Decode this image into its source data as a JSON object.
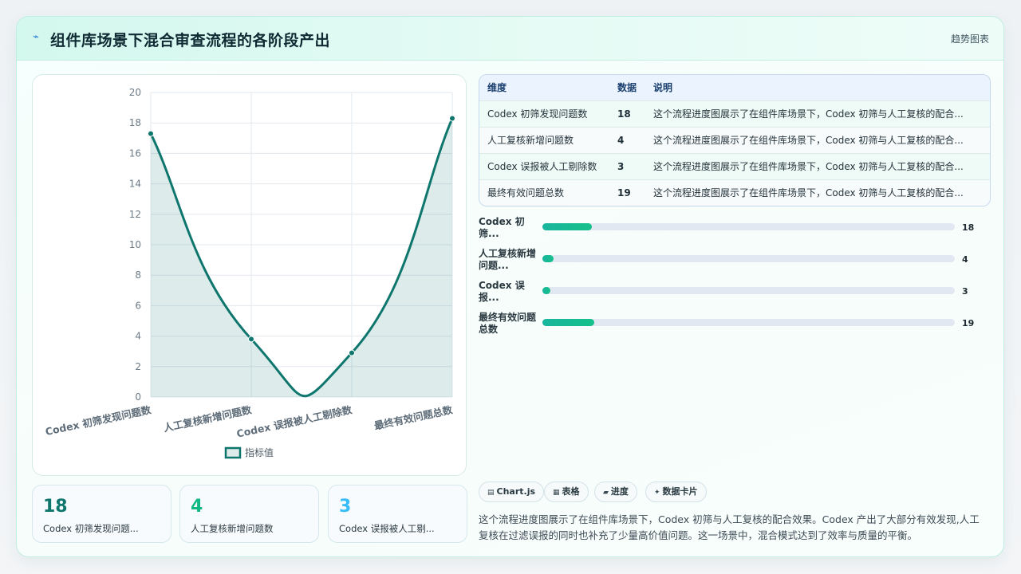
{
  "header": {
    "icon": "lightning-icon",
    "title": "组件库场景下混合审查流程的各阶段产出",
    "tag": "趋势图表"
  },
  "chart_data": {
    "type": "area",
    "categories": [
      "Codex 初筛发现问题数",
      "人工复核新增问题数",
      "Codex 误报被人工剔除数",
      "最终有效问题总数"
    ],
    "series": [
      {
        "name": "指标值",
        "values": [
          17.3,
          3.8,
          2.9,
          18.3
        ]
      }
    ],
    "y_ticks": [
      "0",
      "2",
      "4",
      "6",
      "8",
      "10",
      "12",
      "14",
      "16",
      "18",
      "20"
    ],
    "ylim": [
      0,
      20
    ],
    "grid": true,
    "legend": "bottom",
    "colors": {
      "line": "#0f766e",
      "fill": "rgba(15,118,110,0.14)"
    }
  },
  "table": {
    "headers": [
      "维度",
      "数据",
      "说明"
    ],
    "rows": [
      {
        "dim": "Codex 初筛发现问题数",
        "val": "18",
        "note": "这个流程进度图展示了在组件库场景下，Codex 初筛与人工复核的配合..."
      },
      {
        "dim": "人工复核新增问题数",
        "val": "4",
        "note": "这个流程进度图展示了在组件库场景下，Codex 初筛与人工复核的配合..."
      },
      {
        "dim": "Codex 误报被人工剔除数",
        "val": "3",
        "note": "这个流程进度图展示了在组件库场景下，Codex 初筛与人工复核的配合..."
      },
      {
        "dim": "最终有效问题总数",
        "val": "19",
        "note": "这个流程进度图展示了在组件库场景下，Codex 初筛与人工复核的配合..."
      }
    ]
  },
  "progress": {
    "max": 150,
    "items": [
      {
        "label": "Codex 初筛...",
        "value": 18
      },
      {
        "label": "人工复核新增问题...",
        "value": 4
      },
      {
        "label": "Codex 误报...",
        "value": 3
      },
      {
        "label": "最终有效问题总数",
        "value": 19
      }
    ]
  },
  "stats": [
    {
      "value": "18",
      "label": "Codex 初筛发现问题...",
      "color": "#0f766e"
    },
    {
      "value": "4",
      "label": "人工复核新增问题数",
      "color": "#10b981"
    },
    {
      "value": "3",
      "label": "Codex 误报被人工剔...",
      "color": "#38bdf8"
    }
  ],
  "chips": [
    {
      "icon": "chart-icon",
      "glyph": "▤",
      "label": "Chart.js"
    },
    {
      "icon": "table-icon",
      "glyph": "▦",
      "label": "表格"
    },
    {
      "icon": "progress-icon",
      "glyph": "▰",
      "label": "进度"
    },
    {
      "icon": "sparkle-icon",
      "glyph": "✦",
      "label": "数据卡片"
    }
  ],
  "description": "这个流程进度图展示了在组件库场景下，Codex 初筛与人工复核的配合效果。Codex 产出了大部分有效发现,人工复核在过滤误报的同时也补充了少量高价值问题。这一场景中，混合模式达到了效率与质量的平衡。"
}
